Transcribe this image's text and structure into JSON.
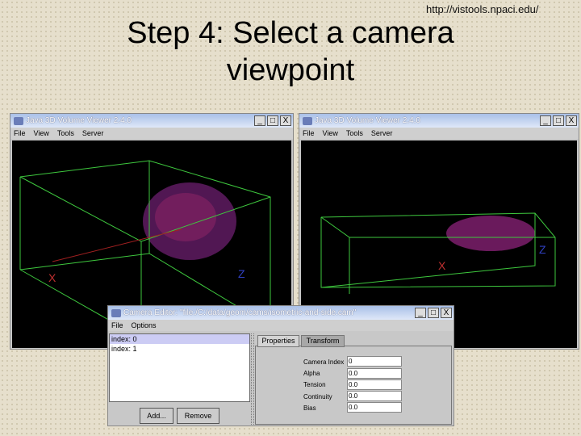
{
  "slide": {
    "url": "http://vistools.npaci.edu/",
    "title": "Step 4: Select a camera viewpoint"
  },
  "viewer_left": {
    "title": "Java 3D Volume Viewer 2.4.0",
    "menu": [
      "File",
      "View",
      "Tools",
      "Server"
    ],
    "axes": {
      "x": "X",
      "z": "Z"
    }
  },
  "viewer_right": {
    "title": "Java 3D Volume Viewer 2.4.0",
    "menu": [
      "File",
      "View",
      "Tools",
      "Server"
    ],
    "axes": {
      "x": "X",
      "z": "Z"
    }
  },
  "camera_editor": {
    "title": "Camera Editor: \"file:/C:/data/geom/cams/isometric-and-side.cam\"",
    "menu": [
      "File",
      "Options"
    ],
    "list": [
      "index: 0",
      "index: 1"
    ],
    "selected_index": 0,
    "add_label": "Add...",
    "remove_label": "Remove",
    "tabs": [
      "Properties",
      "Transform"
    ],
    "active_tab": "Properties",
    "fields": [
      {
        "label": "Camera Index",
        "value": "0"
      },
      {
        "label": "Alpha",
        "value": "0.0"
      },
      {
        "label": "Tension",
        "value": "0.0"
      },
      {
        "label": "Continuity",
        "value": "0.0"
      },
      {
        "label": "Bias",
        "value": "0.0"
      }
    ]
  },
  "window_buttons": {
    "minimize": "_",
    "maximize": "□",
    "close": "X"
  }
}
